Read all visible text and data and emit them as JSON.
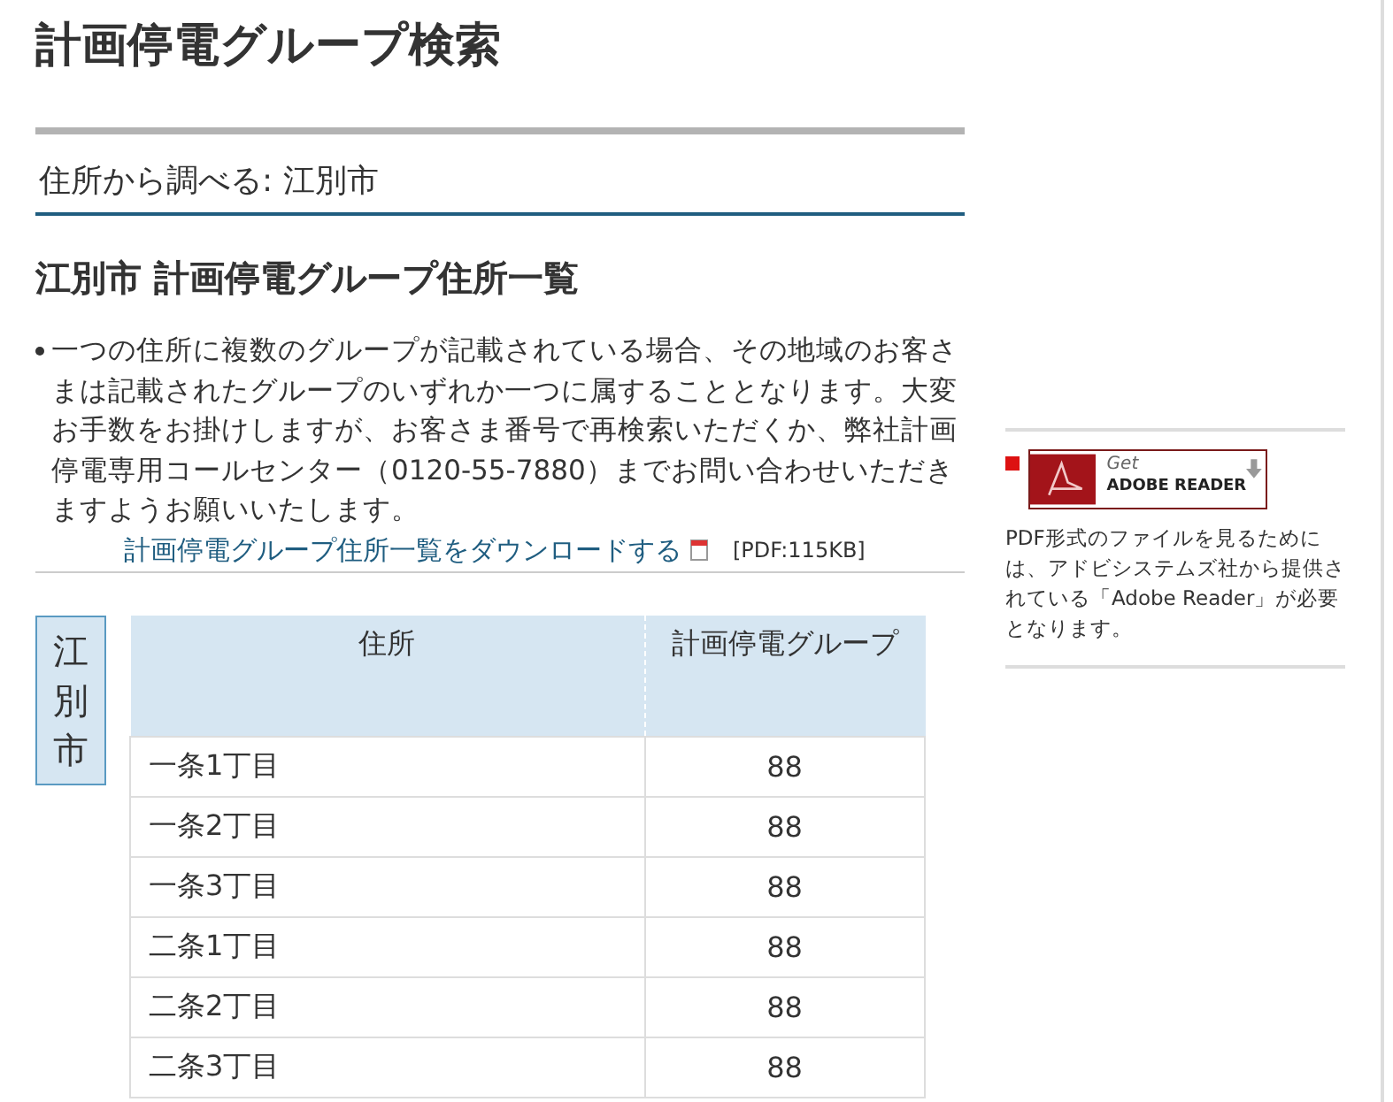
{
  "page_title": "計画停電グループ検索",
  "breadcrumb": "住所から調べる: 江別市",
  "section_title": "江別市 計画停電グループ住所一覧",
  "notes": [
    "一つの住所に複数のグループが記載されている場合、その地域のお客さまは記載されたグループのいずれか一つに属することとなります。大変お手数をお掛けしますが、お客さま番号で再検索いただくか、弊社計画停電専用コールセンター（0120-55-7880）までお問い合わせいただきますようお願いいたします。"
  ],
  "download": {
    "link": "計画停電グループ住所一覧をダウンロードする",
    "size": "[PDF:115KB]"
  },
  "city_tab": "江別市",
  "table": {
    "columns": [
      "住所",
      "計画停電グループ"
    ],
    "rows": [
      {
        "address": "一条1丁目",
        "group": "88"
      },
      {
        "address": "一条2丁目",
        "group": "88"
      },
      {
        "address": "一条3丁目",
        "group": "88"
      },
      {
        "address": "二条1丁目",
        "group": "88"
      },
      {
        "address": "二条2丁目",
        "group": "88"
      },
      {
        "address": "二条3丁目",
        "group": "88"
      }
    ]
  },
  "sidebar": {
    "badge_small": "Get",
    "badge_large": "ADOBE READER",
    "text": "PDF形式のファイルを見るためには、アドビシステムズ社から提供されている「Adobe Reader」が必要となります。"
  }
}
